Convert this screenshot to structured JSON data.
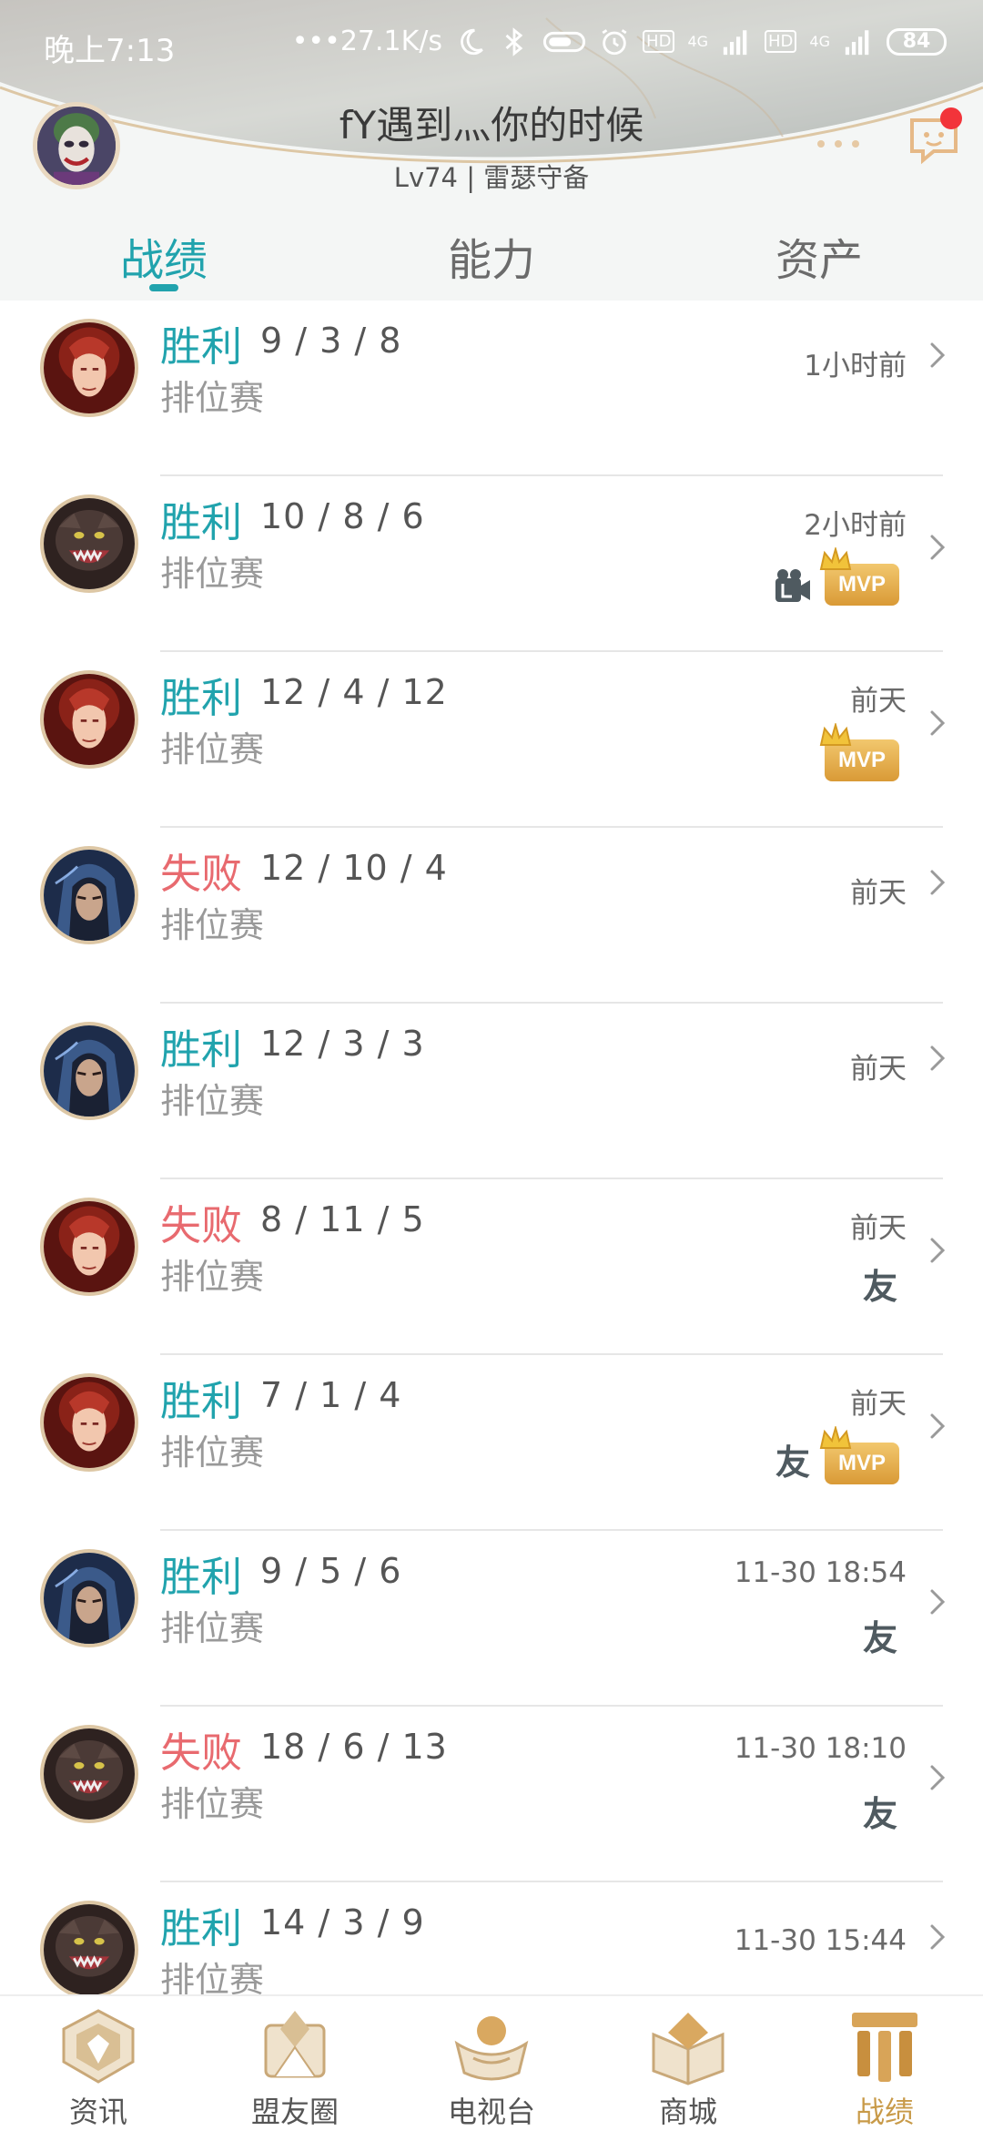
{
  "status_bar": {
    "time": "晚上7:13",
    "net_speed": "27.1K/s",
    "battery": "84",
    "hd1": "HD",
    "hd2": "HD",
    "net1": "4G",
    "net2": "4G"
  },
  "profile": {
    "name": "fY遇到灬你的时候",
    "level_title": "Lv74 | 雷瑟守备",
    "has_notification": true
  },
  "tabs": [
    {
      "label": "战绩",
      "active": true
    },
    {
      "label": "能力",
      "active": false
    },
    {
      "label": "资产",
      "active": false
    }
  ],
  "matches": [
    {
      "result": "胜利",
      "win": true,
      "kda": "9 / 3 / 8",
      "mode": "排位赛",
      "time": "1小时前",
      "hero": "red",
      "mvp": false,
      "friend": false,
      "video": false
    },
    {
      "result": "胜利",
      "win": true,
      "kda": "10 / 8 / 6",
      "mode": "排位赛",
      "time": "2小时前",
      "hero": "beast",
      "mvp": true,
      "friend": false,
      "video": true
    },
    {
      "result": "胜利",
      "win": true,
      "kda": "12 / 4 / 12",
      "mode": "排位赛",
      "time": "前天",
      "hero": "red",
      "mvp": true,
      "friend": false,
      "video": false
    },
    {
      "result": "失败",
      "win": false,
      "kda": "12 / 10 / 4",
      "mode": "排位赛",
      "time": "前天",
      "hero": "hood",
      "mvp": false,
      "friend": false,
      "video": false
    },
    {
      "result": "胜利",
      "win": true,
      "kda": "12 / 3 / 3",
      "mode": "排位赛",
      "time": "前天",
      "hero": "hood",
      "mvp": false,
      "friend": false,
      "video": false
    },
    {
      "result": "失败",
      "win": false,
      "kda": "8 / 11 / 5",
      "mode": "排位赛",
      "time": "前天",
      "hero": "red",
      "mvp": false,
      "friend": true,
      "video": false
    },
    {
      "result": "胜利",
      "win": true,
      "kda": "7 / 1 / 4",
      "mode": "排位赛",
      "time": "前天",
      "hero": "red",
      "mvp": true,
      "friend": true,
      "video": false
    },
    {
      "result": "胜利",
      "win": true,
      "kda": "9 / 5 / 6",
      "mode": "排位赛",
      "time": "11-30 18:54",
      "hero": "hood",
      "mvp": false,
      "friend": true,
      "video": false
    },
    {
      "result": "失败",
      "win": false,
      "kda": "18 / 6 / 13",
      "mode": "排位赛",
      "time": "11-30 18:10",
      "hero": "beast",
      "mvp": false,
      "friend": true,
      "video": false
    },
    {
      "result": "胜利",
      "win": true,
      "kda": "14 / 3 / 9",
      "mode": "排位赛",
      "time": "11-30 15:44",
      "hero": "beast",
      "mvp": false,
      "friend": false,
      "video": false
    }
  ],
  "badges": {
    "mvp": "MVP",
    "friend": "友"
  },
  "bottom_nav": [
    {
      "label": "资讯",
      "icon": "news-icon",
      "active": false
    },
    {
      "label": "盟友圈",
      "icon": "ally-circle-icon",
      "active": false
    },
    {
      "label": "电视台",
      "icon": "tv-icon",
      "active": false
    },
    {
      "label": "商城",
      "icon": "store-icon",
      "active": false
    },
    {
      "label": "战绩",
      "icon": "record-icon",
      "active": true
    }
  ],
  "colors": {
    "accent": "#21a3ad",
    "win": "#21a3ad",
    "lose": "#e86a6f",
    "gold": "#c89a48",
    "mvp": "#e0a545"
  }
}
